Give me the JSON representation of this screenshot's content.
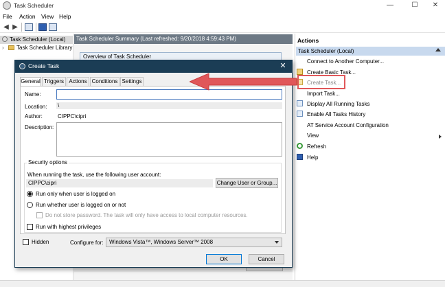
{
  "window": {
    "title": "Task Scheduler",
    "controls": {
      "minimize": "—",
      "maximize": "☐",
      "close": "✕"
    }
  },
  "menu": [
    "File",
    "Action",
    "View",
    "Help"
  ],
  "tree": {
    "items": [
      {
        "label": "Task Scheduler (Local)"
      },
      {
        "label": "Task Scheduler Library"
      }
    ]
  },
  "center": {
    "header": "Task Scheduler Summary (Last refreshed: 9/20/2018 4:59:43 PM)",
    "overview": "Overview of Task Scheduler"
  },
  "actions": {
    "title": "Actions",
    "group": "Task Scheduler (Local)",
    "items": [
      {
        "label": "Connect to Another Computer...",
        "icon": "connect-icon"
      },
      {
        "label": "Create Basic Task...",
        "icon": "create-basic-task-icon"
      },
      {
        "label": "Create Task...",
        "icon": "create-task-icon"
      },
      {
        "label": "Import Task...",
        "icon": "import-icon"
      },
      {
        "label": "Display All Running Tasks",
        "icon": "running-tasks-icon"
      },
      {
        "label": "Enable All Tasks History",
        "icon": "history-icon"
      },
      {
        "label": "AT Service Account Configuration",
        "icon": ""
      },
      {
        "label": "View",
        "icon": ""
      },
      {
        "label": "Refresh",
        "icon": "refresh-icon"
      },
      {
        "label": "Help",
        "icon": "help-icon"
      }
    ]
  },
  "dialog": {
    "title": "Create Task",
    "tabs": [
      "General",
      "Triggers",
      "Actions",
      "Conditions",
      "Settings"
    ],
    "name_label": "Name:",
    "name_value": "",
    "location_label": "Location:",
    "location_value": "\\",
    "author_label": "Author:",
    "author_value": "CIPPC\\cipri",
    "description_label": "Description:",
    "security": {
      "legend": "Security options",
      "prompt": "When running the task, use the following user account:",
      "user_account": "CIPPC\\cipri",
      "change_button": "Change User or Group...",
      "options": [
        {
          "label": "Run only when user is logged on",
          "selected": true
        },
        {
          "label": "Run whether user is logged on or not",
          "selected": false
        }
      ],
      "no_store_password": "Do not store password.  The task will only have access to local computer resources.",
      "highest_privileges": "Run with highest privileges"
    },
    "hidden_label": "Hidden",
    "configure_label": "Configure for:",
    "configure_value": "Windows Vista™, Windows Server™ 2008",
    "ok_label": "OK",
    "cancel_label": "Cancel"
  },
  "colors": {
    "dialog_titlebar": "#1b3d55",
    "header_bar": "#6d7985",
    "actions_group": "#c8d9ee",
    "annotation": "#e0575a"
  }
}
